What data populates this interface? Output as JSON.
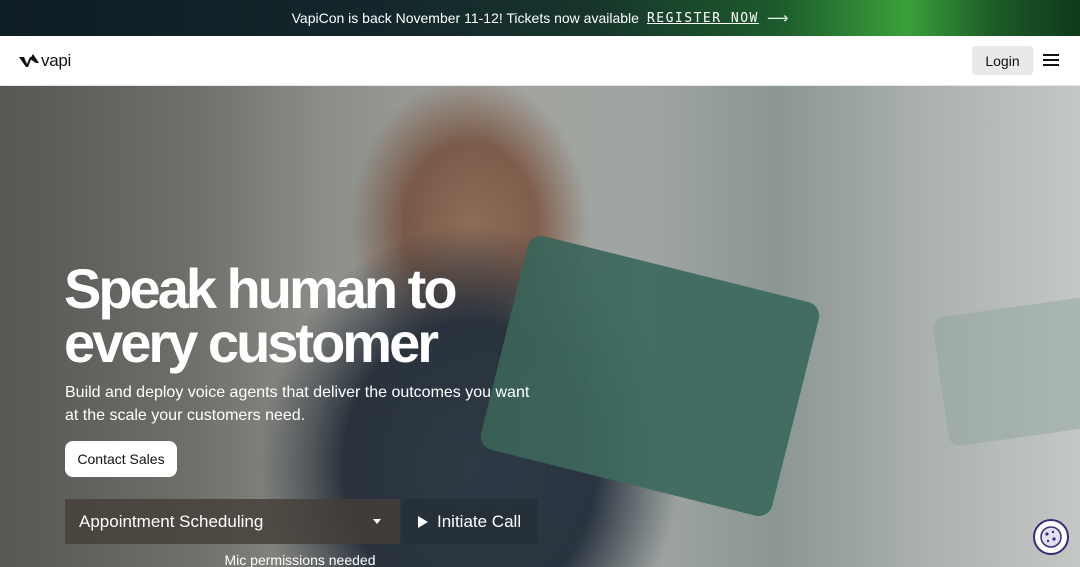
{
  "announcement": {
    "text": "VapiCon is back November 11-12! Tickets now available",
    "cta": "REGISTER NOW",
    "arrow": "⟶"
  },
  "header": {
    "logo_text": "vapi",
    "login_label": "Login",
    "menu_icon": "hamburger-menu-icon"
  },
  "hero": {
    "title_line1": "Speak human to",
    "title_line2": "every customer",
    "subtitle": "Build and deploy voice agents that deliver the outcomes you want at the scale your customers need.",
    "contact_label": "Contact Sales",
    "scenario_value": "Appointment Scheduling",
    "call_label": "Initiate Call",
    "mic_note": "Mic permissions needed"
  },
  "colors": {
    "accent_green": "#3aa13a",
    "cookie_border": "#3a2a7a"
  }
}
